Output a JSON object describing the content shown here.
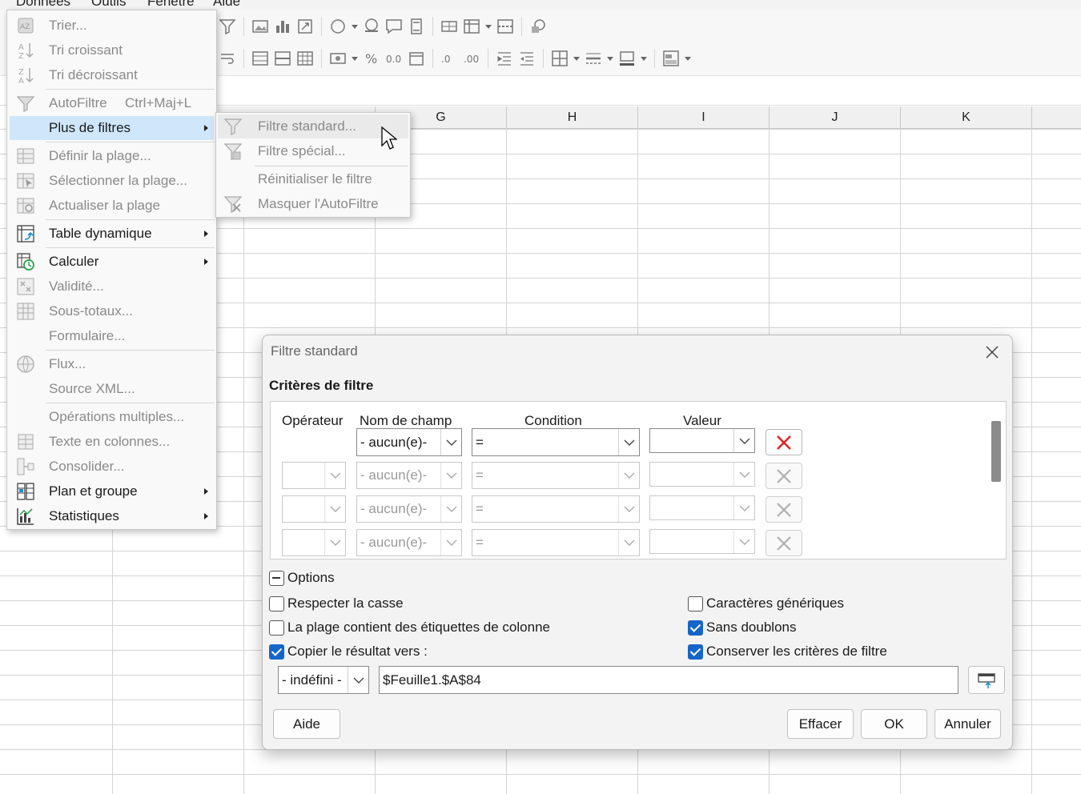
{
  "menubar": {
    "items": [
      "Données",
      "Outils",
      "Fenêtre",
      "Aide"
    ]
  },
  "sheet": {
    "columns": [
      "G",
      "H",
      "I",
      "J",
      "K"
    ]
  },
  "data_menu": {
    "items": [
      {
        "label": "Trier...",
        "icon": "sort-az-icon",
        "disabled": true
      },
      {
        "label": "Tri croissant",
        "icon": "sort-ascending-icon",
        "disabled": true
      },
      {
        "label": "Tri décroissant",
        "icon": "sort-descending-icon",
        "disabled": true
      },
      {
        "label": "AutoFiltre",
        "shortcut": "Ctrl+Maj+L",
        "icon": "autofilter-icon",
        "disabled": true
      },
      {
        "label": "Plus de filtres",
        "icon": "",
        "submenu": true,
        "highlighted": true
      },
      {
        "label": "Définir la plage...",
        "icon": "define-range-icon",
        "disabled": true
      },
      {
        "label": "Sélectionner la plage...",
        "icon": "select-range-icon",
        "disabled": true
      },
      {
        "label": "Actualiser la plage",
        "icon": "refresh-range-icon",
        "disabled": true
      },
      {
        "label": "Table dynamique",
        "icon": "pivot-table-icon",
        "submenu": true
      },
      {
        "label": "Calculer",
        "icon": "calculate-icon",
        "submenu": true
      },
      {
        "label": "Validité...",
        "icon": "validity-icon",
        "disabled": true
      },
      {
        "label": "Sous-totaux...",
        "icon": "subtotals-icon",
        "disabled": true
      },
      {
        "label": "Formulaire...",
        "icon": "",
        "disabled": true
      },
      {
        "label": "Flux...",
        "icon": "globe-icon",
        "disabled": true
      },
      {
        "label": "Source XML...",
        "icon": "",
        "disabled": true
      },
      {
        "label": "Opérations multiples...",
        "icon": "",
        "disabled": true
      },
      {
        "label": "Texte en colonnes...",
        "icon": "text-to-columns-icon",
        "disabled": true
      },
      {
        "label": "Consolider...",
        "icon": "consolidate-icon",
        "disabled": true
      },
      {
        "label": "Plan et groupe",
        "icon": "outline-group-icon",
        "submenu": true
      },
      {
        "label": "Statistiques",
        "icon": "statistics-icon",
        "submenu": true
      }
    ]
  },
  "filters_submenu": {
    "items": [
      {
        "label": "Filtre standard...",
        "icon": "standard-filter-icon"
      },
      {
        "label": "Filtre spécial...",
        "icon": "special-filter-icon"
      },
      {
        "label": "Réinitialiser le filtre",
        "icon": ""
      },
      {
        "label": "Masquer l'AutoFiltre",
        "icon": "hide-autofilter-icon"
      }
    ]
  },
  "dialog": {
    "title": "Filtre standard",
    "section_title": "Critères de filtre",
    "headers": {
      "operator": "Opérateur",
      "field": "Nom de champ",
      "condition": "Condition",
      "value": "Valeur"
    },
    "rows": [
      {
        "operator": "",
        "field": "- aucun(e)-",
        "condition": "=",
        "value": "",
        "enabled": true
      },
      {
        "operator": "",
        "field": "- aucun(e)-",
        "condition": "=",
        "value": "",
        "enabled": false
      },
      {
        "operator": "",
        "field": "- aucun(e)-",
        "condition": "=",
        "value": "",
        "enabled": false
      },
      {
        "operator": "",
        "field": "- aucun(e)-",
        "condition": "=",
        "value": "",
        "enabled": false
      }
    ],
    "options_label": "Options",
    "options": {
      "case_sensitive": {
        "label": "Respecter la casse",
        "checked": false
      },
      "has_headers": {
        "label": "La plage contient des étiquettes de colonne",
        "checked": false
      },
      "copy_results": {
        "label": "Copier le résultat vers :",
        "checked": true
      },
      "wildcards": {
        "label": "Caractères génériques",
        "checked": false
      },
      "no_duplicates": {
        "label": "Sans doublons",
        "checked": true
      },
      "keep_criteria": {
        "label": "Conserver les critères de filtre",
        "checked": true
      }
    },
    "copy_target_select": "- indéfini -",
    "copy_target_value": "$Feuille1.$A$84",
    "buttons": {
      "help": "Aide",
      "reset": "Effacer",
      "ok": "OK",
      "cancel": "Annuler"
    }
  },
  "colors": {
    "highlight": "#cfe6fb",
    "checkbox_on": "#1466c8",
    "delete_red": "#e02020"
  }
}
